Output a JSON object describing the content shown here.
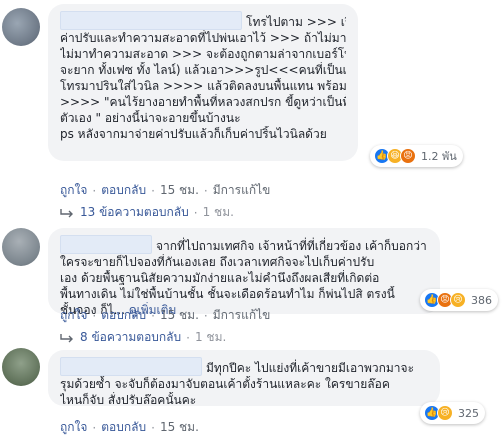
{
  "comments": [
    {
      "lines": [
        "โทรไปตาม >>> เรียกมาจ่าย",
        "ค่าปรับและทำความสะอาดที่ไปพ่นเอาไว้ >>> ถ้าไม่มาจ่ายค่าปรับ",
        "ไม่มาทำความสะอาด >>> จะต้องถูกตามล่าจากเบอร์โทร (ซึ่งไม่น่า",
        "จะยาก ทั้งเฟซ ทั้ง ไลน์) แล้วเอา>>>รูป<<<คนที่เป็นเจ้าของเบอร์",
        "โทรมาปรินใส่ไวนิล >>>> แล้วติดลงบนพื้นแทน พร้อมข้อความ",
        ">>>> \"คนไร้ยางอายทำพื้นที่หลวงสกปรก ขี้ดูหว่าเป็นพื้นที่ของ",
        "ตัวเอง \" อย่างนี้น่าจะอายขึ้นบ้างนะ",
        "ps หลังจากมาจ่ายค่าปรับแล้วก็เก็บค่าปริ้นไวนิลด้วย"
      ],
      "reaction_count": "1.2 พัน",
      "reply_label": "ตอบกลับ",
      "like_label": "ถูกใจ",
      "time": "15 ชม.",
      "edited": "มีการแก้ไข",
      "replies": {
        "label": "13 ข้อความตอบกลับ",
        "time": "1 ชม."
      }
    },
    {
      "lines": [
        "จากที่ไปถามเทศกิจ เจ้าหน้าที่ที่เกี่ยวข้อง เค้าก็บอกว่า",
        "ใครจะขายก็ไปจองที่กันเองเลย ถึงเวลาเทศกิจจะไปเก็บค่าปรับ",
        "เอง ด้วยพื้นฐานนิสัยความมักง่ายและไม่คำนึงถึงผลเสียที่เกิดต่อ",
        "พื้นทางเดิน ไม่ใช่พื้นบ้านชั้น ชั้นจะเดือดร้อนทำไม ก็พ่นไปสิ ตรงนี้",
        "ชั้นจอง ก็ไ..."
      ],
      "more_label": "ดูเพิ่มเติม",
      "reaction_count": "386",
      "reply_label": "ตอบกลับ",
      "like_label": "ถูกใจ",
      "time": "15 ชม.",
      "edited": "มีการแก้ไข",
      "replies": {
        "label": "8 ข้อความตอบกลับ",
        "time": "1 ชม."
      }
    },
    {
      "lines": [
        "มีทุกปีคะ ไปแย่งที่เค้าขายมีเอาพวกมาจะ",
        "รุมด้วยซ้ำ จะจับก็ต้องมาจับตอนเค้าตั้งร้านแหละคะ ใครขายล๊อค",
        "ไหนก็จับ สั่งปรับล๊อคนั้นคะ"
      ],
      "reaction_count": "325",
      "reply_label": "ตอบกลับ",
      "like_label": "ถูกใจ",
      "time": "15 ชม."
    }
  ]
}
